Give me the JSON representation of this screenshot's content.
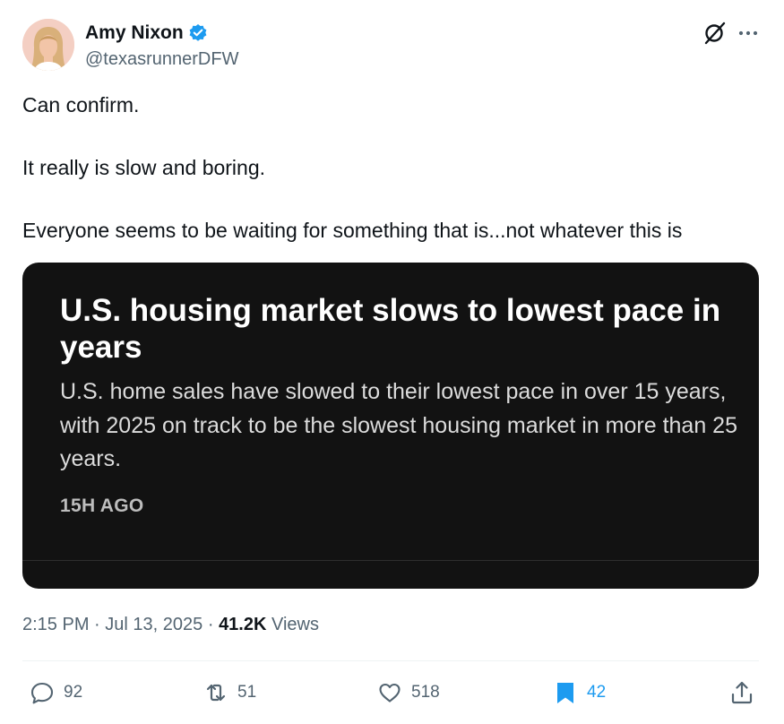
{
  "author": {
    "name": "Amy Nixon",
    "handle": "@texasrunnerDFW",
    "verified": true
  },
  "header_icons": [
    "grok-icon",
    "more-icon"
  ],
  "tweet": {
    "line1": "Can confirm.",
    "line2": "It really is slow and boring.",
    "line3": "Everyone seems to be waiting for something that is...not whatever this is"
  },
  "media": {
    "headline": "U.S. housing market slows to lowest pace in years",
    "body": "U.S. home sales have slowed to their lowest pace in over 15 years, with 2025 on track to be the slowest housing market in more than 25 years.",
    "time": "15H AGO"
  },
  "meta": {
    "time": "2:15 PM",
    "separator": "·",
    "date": "Jul 13, 2025",
    "views_count": "41.2K",
    "views_label": "Views"
  },
  "actions": {
    "replies": "92",
    "reposts": "51",
    "likes": "518",
    "bookmarks": "42"
  },
  "colors": {
    "verified": "#1d9bf0",
    "text": "#0f1419",
    "secondary": "#536471",
    "card_bg": "#121212",
    "bookmark_active": "#1d9bf0"
  }
}
